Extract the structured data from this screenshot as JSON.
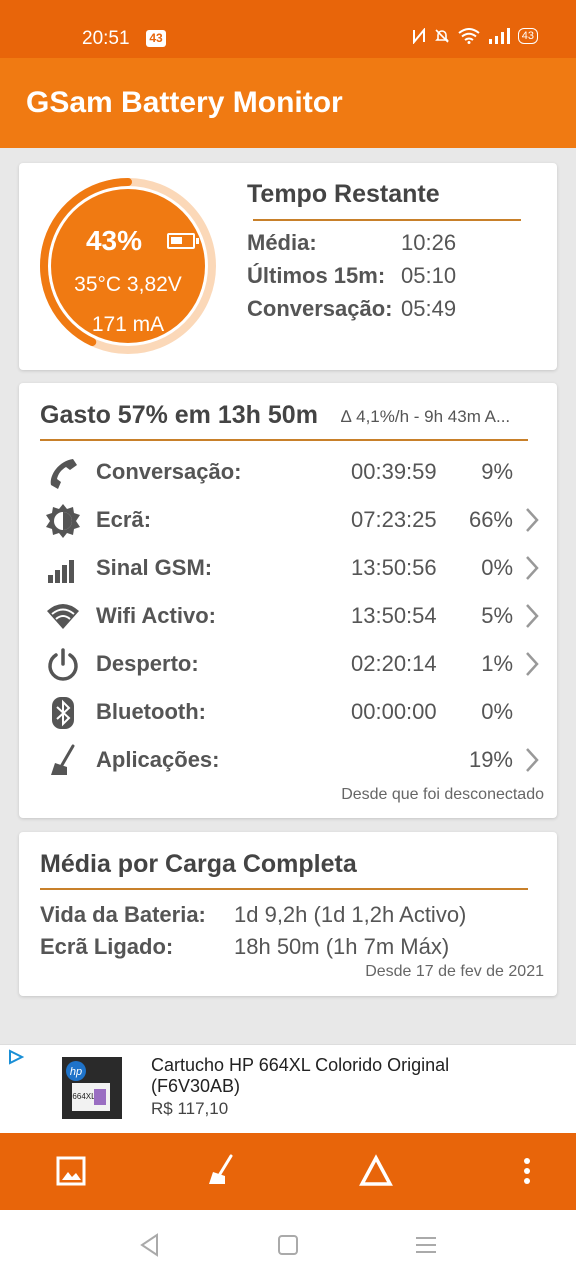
{
  "status_bar": {
    "time": "20:51",
    "left_badge": "43",
    "battery": "43"
  },
  "app_bar": {
    "title": "GSam Battery Monitor"
  },
  "battery_gauge": {
    "percent": "43%",
    "level": 0.43,
    "temp_voltage": "35°C 3,82V",
    "current": "171 mA"
  },
  "time_remaining": {
    "title": "Tempo Restante",
    "rows": [
      {
        "label": "Média:",
        "value": "10:26"
      },
      {
        "label": "Últimos 15m:",
        "value": "05:10"
      },
      {
        "label": "Conversação:",
        "value": "05:49"
      }
    ]
  },
  "usage": {
    "title": "Gasto 57% em 13h 50m",
    "rate": "∆ 4,1%/h - 9h 43m A...",
    "rows": [
      {
        "icon": "phone-icon",
        "label": "Conversação:",
        "time": "00:39:59",
        "pct": "9%",
        "chevron": false
      },
      {
        "icon": "brightness-icon",
        "label": "Ecrã:",
        "time": "07:23:25",
        "pct": "66%",
        "chevron": true
      },
      {
        "icon": "signal-icon",
        "label": "Sinal GSM:",
        "time": "13:50:56",
        "pct": "0%",
        "chevron": true
      },
      {
        "icon": "wifi-icon",
        "label": "Wifi Activo:",
        "time": "13:50:54",
        "pct": "5%",
        "chevron": true
      },
      {
        "icon": "power-icon",
        "label": "Desperto:",
        "time": "02:20:14",
        "pct": "1%",
        "chevron": true
      },
      {
        "icon": "bluetooth-icon",
        "label": "Bluetooth:",
        "time": "00:00:00",
        "pct": "0%",
        "chevron": false
      },
      {
        "icon": "broom-icon",
        "label": "Aplicações:",
        "time": "",
        "pct": "19%",
        "chevron": true
      }
    ],
    "footer": "Desde que foi desconectado"
  },
  "average": {
    "title": "Média por Carga Completa",
    "rows": [
      {
        "label": "Vida da Bateria:",
        "value": "1d 9,2h (1d 1,2h Activo)"
      },
      {
        "label": "Ecrã Ligado:",
        "value": "18h 50m (1h 7m Máx)"
      }
    ],
    "footer": "Desde 17 de fev de 2021"
  },
  "ad": {
    "title": "Cartucho HP 664XL Colorido Original (F6V30AB)",
    "price": "R$ 117,10",
    "product_label": "664XL"
  },
  "colors": {
    "status_bar": "#e8650a",
    "app_bar": "#f07a12",
    "accent_line": "#c8802a",
    "gauge_fill": "#f07a12",
    "gauge_track": "#fbd8b8"
  }
}
